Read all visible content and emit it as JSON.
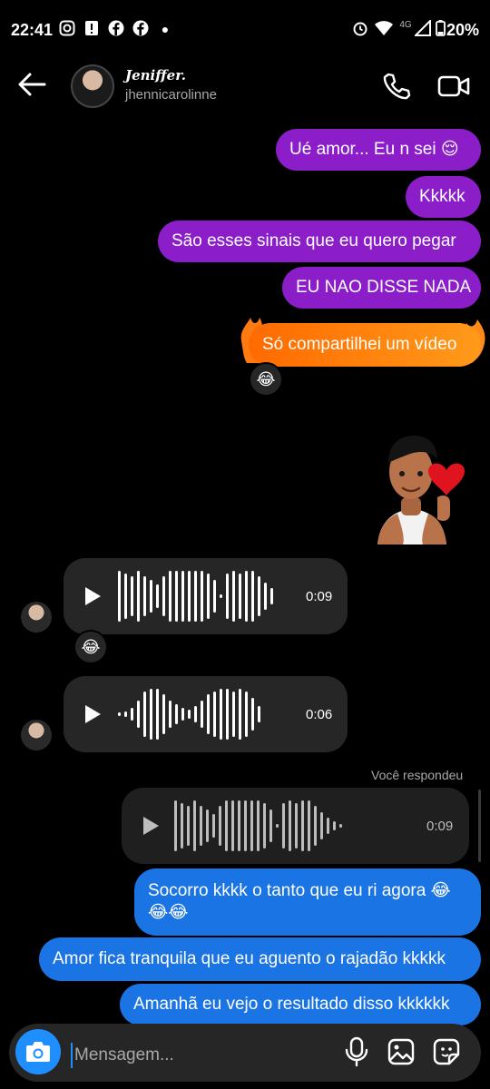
{
  "status_bar": {
    "time": "22:41",
    "network": "4G",
    "battery": "20%"
  },
  "header": {
    "display_name": "Jeniffer.",
    "username": "jhennicarolinne"
  },
  "messages": [
    {
      "text": "Ué amor... Eu n sei 😌"
    },
    {
      "text": "Kkkkk"
    },
    {
      "text": "São esses sinais que eu quero pegar"
    },
    {
      "text": "EU NAO DISSE NADA"
    },
    {
      "text": "Só compartilhei um vídeo",
      "reaction": "😂"
    },
    {
      "text": "Socorro kkkk o tanto que eu ri agora 😂",
      "text2": "😂😂"
    },
    {
      "text": "Amor fica tranquila que eu aguento o rajadão kkkkk"
    },
    {
      "text": "Amanhã eu vejo o resultado disso kkkkkk"
    }
  ],
  "audio": [
    {
      "duration": "0:09",
      "reaction": "😂"
    },
    {
      "duration": "0:06"
    },
    {
      "duration": "0:09"
    }
  ],
  "replied_label": "Você respondeu",
  "composer": {
    "placeholder": "Mensagem..."
  }
}
